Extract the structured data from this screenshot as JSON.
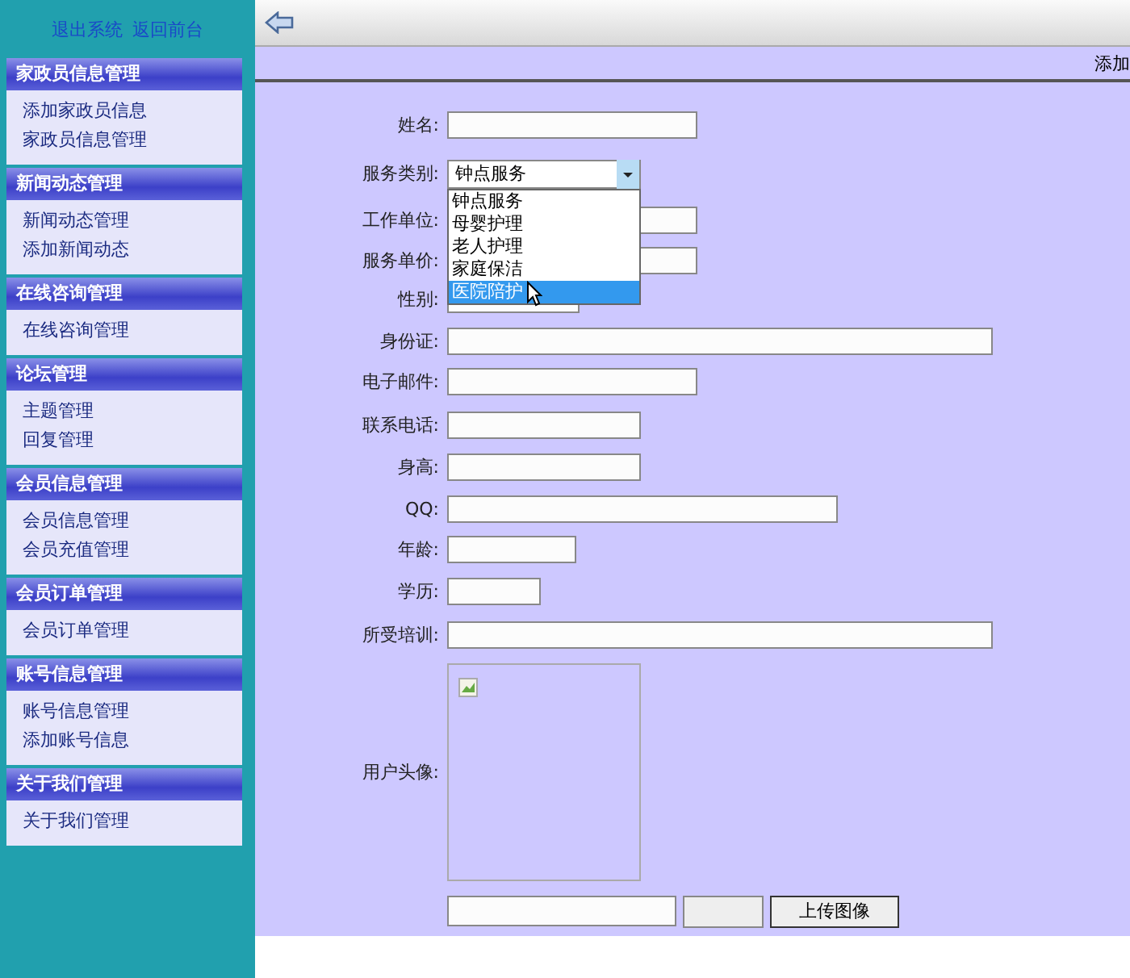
{
  "top_links": [
    "退出系统",
    "返回前台"
  ],
  "sidebar": {
    "groups": [
      {
        "title": "家政员信息管理",
        "items": [
          "添加家政员信息",
          "家政员信息管理"
        ]
      },
      {
        "title": "新闻动态管理",
        "items": [
          "新闻动态管理",
          "添加新闻动态"
        ]
      },
      {
        "title": "在线咨询管理",
        "items": [
          "在线咨询管理"
        ]
      },
      {
        "title": "论坛管理",
        "items": [
          "主题管理",
          "回复管理"
        ]
      },
      {
        "title": "会员信息管理",
        "items": [
          "会员信息管理",
          "会员充值管理"
        ]
      },
      {
        "title": "会员订单管理",
        "items": [
          "会员订单管理"
        ]
      },
      {
        "title": "账号信息管理",
        "items": [
          "账号信息管理",
          "添加账号信息"
        ]
      },
      {
        "title": "关于我们管理",
        "items": [
          "关于我们管理"
        ]
      }
    ]
  },
  "page_title": "添加",
  "form": {
    "fields": [
      {
        "label": "姓名:",
        "kind": "text"
      },
      {
        "label": "服务类别:",
        "kind": "select",
        "value": "钟点服务",
        "expanded": true,
        "options": [
          {
            "label": "钟点服务",
            "highlighted": false
          },
          {
            "label": "母婴护理",
            "highlighted": false
          },
          {
            "label": "老人护理",
            "highlighted": false
          },
          {
            "label": "家庭保洁",
            "highlighted": false
          },
          {
            "label": "医院陪护",
            "highlighted": true
          }
        ]
      },
      {
        "label": "工作单位:",
        "kind": "text"
      },
      {
        "label": "服务单价:",
        "kind": "text"
      },
      {
        "label": "性别:",
        "kind": "text"
      },
      {
        "label": "身份证:",
        "kind": "text"
      },
      {
        "label": "电子邮件:",
        "kind": "text"
      },
      {
        "label": "联系电话:",
        "kind": "text"
      },
      {
        "label": "身高:",
        "kind": "text"
      },
      {
        "label": "QQ:",
        "kind": "text"
      },
      {
        "label": "年龄:",
        "kind": "text"
      },
      {
        "label": "学历:",
        "kind": "text"
      },
      {
        "label": "所受培训:",
        "kind": "text"
      },
      {
        "label": "用户头像:",
        "kind": "image"
      },
      {
        "kind": "upload",
        "button": "上传图像"
      }
    ]
  }
}
